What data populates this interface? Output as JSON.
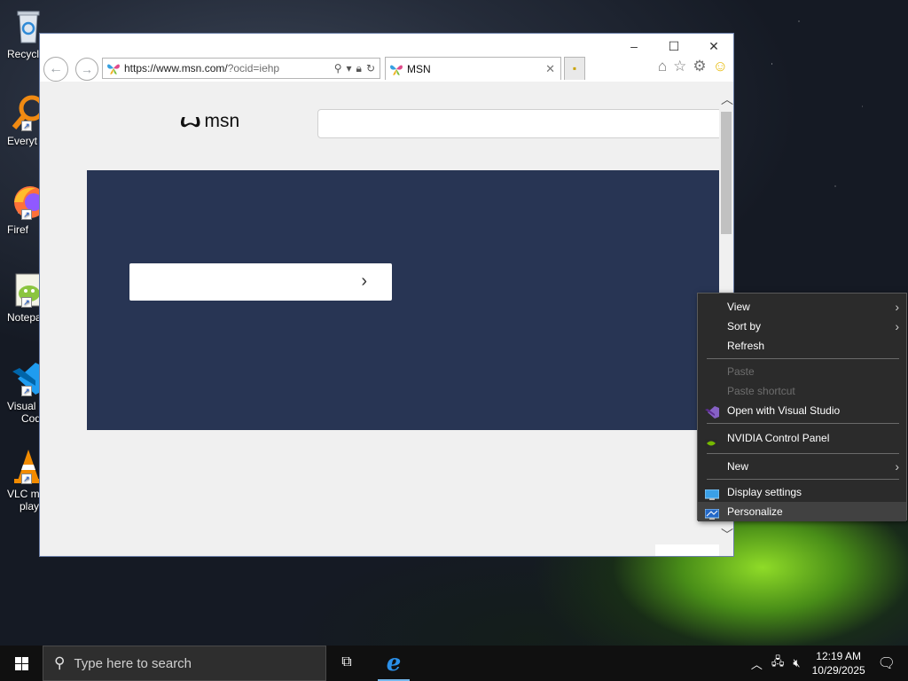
{
  "desktop": {
    "icons": [
      {
        "label": "Recycl",
        "icon": "recycle-bin-icon"
      },
      {
        "label": "Everyt",
        "icon": "everything-search-icon"
      },
      {
        "label": "Firef",
        "icon": "firefox-icon"
      },
      {
        "label": "Notepa",
        "icon": "notepad-plus-plus-icon"
      },
      {
        "label": "Visual S",
        "label2": "Cod",
        "icon": "vscode-icon"
      },
      {
        "label": "VLC m",
        "label2": "play",
        "icon": "vlc-icon"
      }
    ]
  },
  "browser": {
    "url_host": "https://www.msn.com/",
    "url_path": "?ocid=iehp",
    "tab_title": "MSN",
    "logo_text": "msn"
  },
  "context_menu": {
    "items": [
      {
        "label": "View",
        "submenu": true,
        "enabled": true
      },
      {
        "label": "Sort by",
        "submenu": true,
        "enabled": true
      },
      {
        "label": "Refresh",
        "enabled": true
      },
      {
        "label": "Paste",
        "enabled": false
      },
      {
        "label": "Paste shortcut",
        "enabled": false
      },
      {
        "label": "Open with Visual Studio",
        "enabled": true,
        "icon": "visual-studio-icon"
      },
      {
        "label": "NVIDIA Control Panel",
        "enabled": true,
        "icon": "nvidia-icon"
      },
      {
        "label": "New",
        "submenu": true,
        "enabled": true
      },
      {
        "label": "Display settings",
        "enabled": true,
        "icon": "display-icon"
      },
      {
        "label": "Personalize",
        "enabled": true,
        "icon": "personalize-icon",
        "highlighted": true
      }
    ]
  },
  "taskbar": {
    "search_placeholder": "Type here to search",
    "clock_time": "12:19 AM",
    "clock_date": "10/29/2025"
  },
  "colors": {
    "hero_bg": "#283554",
    "menu_bg": "#2b2b2b",
    "taskbar_bg": "#101010",
    "ie_blue": "#2b90e9"
  }
}
